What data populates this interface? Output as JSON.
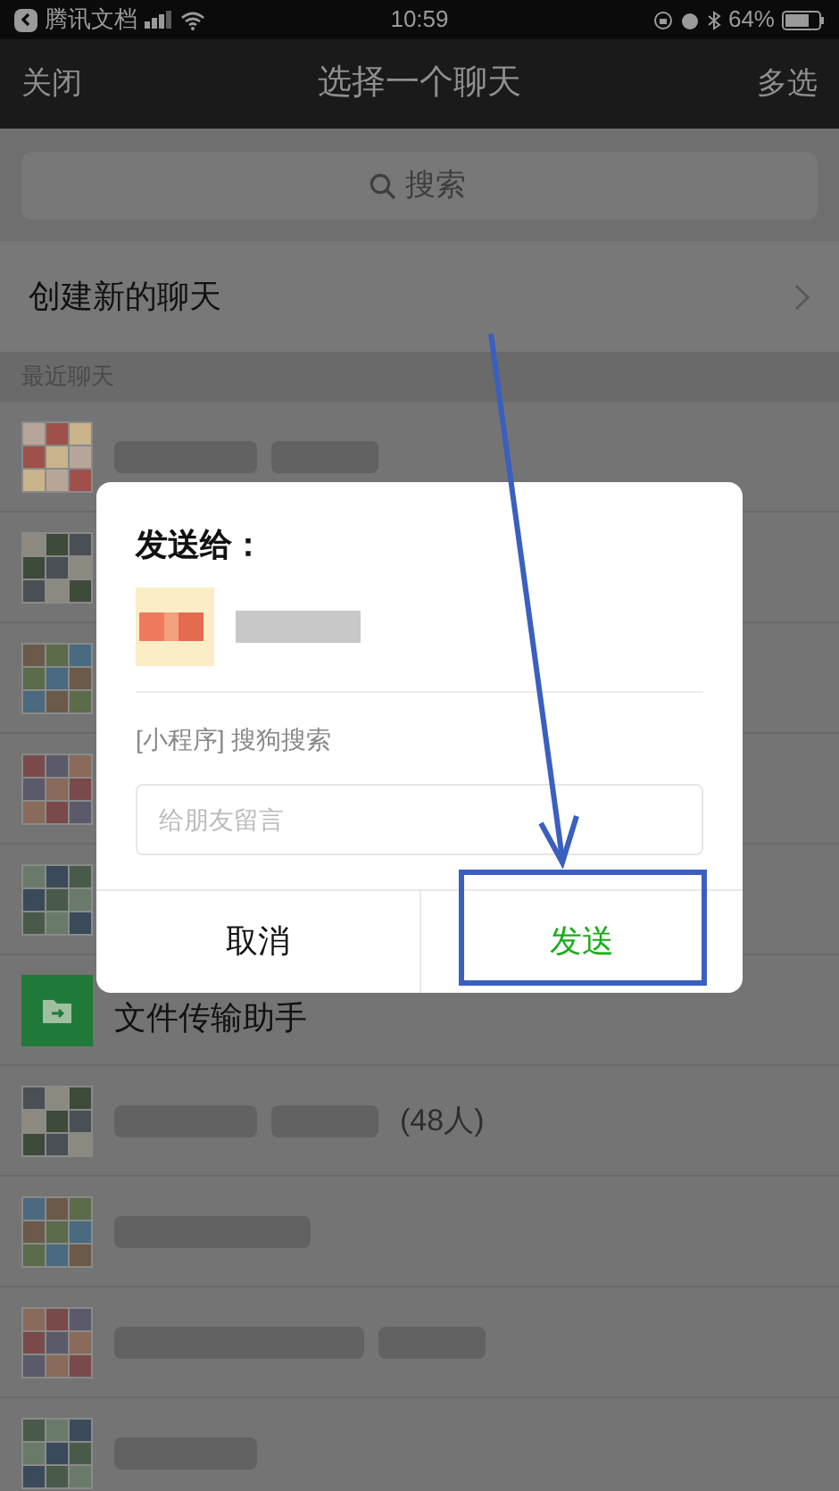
{
  "status_bar": {
    "carrier": "腾讯文档",
    "time": "10:59",
    "battery": "64%"
  },
  "nav": {
    "left": "关闭",
    "title": "选择一个聊天",
    "right": "多选"
  },
  "search": {
    "placeholder": "搜索"
  },
  "create_chat": "创建新的聊天",
  "section": "最近聊天",
  "chats": [
    {
      "kind": "contact"
    },
    {
      "kind": "covered_contact"
    },
    {
      "kind": "covered_contact"
    },
    {
      "kind": "covered_contact"
    },
    {
      "kind": "covered_contact"
    },
    {
      "kind": "file_transfer",
      "name": "文件传输助手"
    },
    {
      "kind": "contact",
      "suffix": "(48人)"
    },
    {
      "kind": "contact"
    },
    {
      "kind": "contact"
    },
    {
      "kind": "contact"
    }
  ],
  "dialog": {
    "title": "发送给：",
    "mini_program": "[小程序] 搜狗搜索",
    "message": {
      "placeholder": "给朋友留言"
    },
    "buttons": [
      {
        "label": "取消",
        "kind": "cancel"
      },
      {
        "label": "发送",
        "kind": "confirm"
      }
    ]
  }
}
